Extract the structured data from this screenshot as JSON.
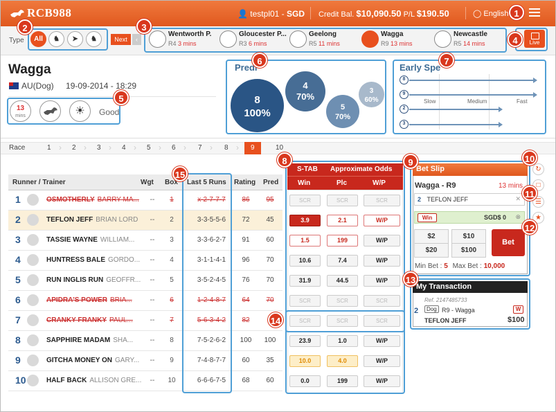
{
  "app": {
    "brand": "RCB988"
  },
  "topbar": {
    "user": "testpl01",
    "currency": "SGD",
    "credit_label": "Credit Bal.",
    "credit_value": "$10,090.50",
    "pl_label": "P/L",
    "pl_value": "$190.50",
    "language": "English"
  },
  "typebar": {
    "label": "Type",
    "all_label": "All",
    "next_label": "Next",
    "prev_glyph": "‹"
  },
  "races": [
    {
      "name": "Wentworth P.",
      "round": "R4",
      "time": "3 mins",
      "kind": "dog"
    },
    {
      "name": "Gloucester P...",
      "round": "R3",
      "time": "6 mins",
      "kind": "horse"
    },
    {
      "name": "Geelong",
      "round": "R5",
      "time": "11 mins",
      "kind": "dog"
    },
    {
      "name": "Wagga",
      "round": "R9",
      "time": "13 mins",
      "kind": "dog"
    },
    {
      "name": "Newcastle",
      "round": "R5",
      "time": "14 mins",
      "kind": "horse"
    }
  ],
  "live_label": "Live",
  "venue": {
    "name": "Wagga",
    "country": "AU(Dog)",
    "date": "19-09-2014 - 18:29",
    "mins_value": "13",
    "mins_unit": "mins",
    "condition": "Good"
  },
  "prediction": {
    "title": "Predi",
    "bubbles": [
      {
        "runner": "8",
        "pct": "100%"
      },
      {
        "runner": "4",
        "pct": "70%"
      },
      {
        "runner": "5",
        "pct": "70%"
      },
      {
        "runner": "3",
        "pct": "60%"
      }
    ]
  },
  "early_speed": {
    "title": "Early Spe",
    "labels": [
      "Slow",
      "Medium",
      "Fast"
    ],
    "rows": [
      {
        "runner": "8",
        "level": 1.0
      },
      {
        "runner": "9",
        "level": 1.0
      },
      {
        "runner": "2",
        "level": 0.72
      },
      {
        "runner": "3",
        "level": 0.72
      }
    ]
  },
  "racebar": {
    "label": "Race",
    "numbers": [
      "1",
      "2",
      "3",
      "4",
      "5",
      "6",
      "7",
      "8",
      "9",
      "10"
    ],
    "selected": "9"
  },
  "grid": {
    "headers": {
      "runner": "Runner / Trainer",
      "wgt": "Wgt",
      "box": "Box",
      "last5": "Last 5 Runs",
      "rating": "Rating",
      "pred": "Pred"
    },
    "rows": [
      {
        "num": "1",
        "horse": "OSMOTHERLY",
        "trainer": "BARRY MA...",
        "wgt": "--",
        "box": "1",
        "last5": "x-2-7-7-7",
        "rating": "86",
        "pred": "95",
        "scr": true,
        "win": "SCR",
        "plc": "SCR",
        "wp": "SCR",
        "style": "scr"
      },
      {
        "num": "2",
        "horse": "TEFLON JEFF",
        "trainer": "BRIAN LORD",
        "wgt": "--",
        "box": "2",
        "last5": "3-3-5-5-6",
        "rating": "72",
        "pred": "45",
        "scr": false,
        "hl": true,
        "win": "3.9",
        "plc": "2.1",
        "wp": "W/P",
        "style": "selected"
      },
      {
        "num": "3",
        "horse": "TASSIE WAYNE",
        "trainer": "WILLIAM...",
        "wgt": "--",
        "box": "3",
        "last5": "3-3-6-2-7",
        "rating": "91",
        "pred": "60",
        "scr": false,
        "win": "1.5",
        "plc": "199",
        "wp": "W/P",
        "style": "redt"
      },
      {
        "num": "4",
        "horse": "HUNTRESS BALE",
        "trainer": "GORDO...",
        "wgt": "--",
        "box": "4",
        "last5": "3-1-1-4-1",
        "rating": "96",
        "pred": "70",
        "scr": false,
        "win": "10.6",
        "plc": "7.4",
        "wp": "W/P",
        "style": "normal"
      },
      {
        "num": "5",
        "horse": "RUN INGLIS RUN",
        "trainer": "GEOFFR...",
        "wgt": "--",
        "box": "5",
        "last5": "3-5-2-4-5",
        "rating": "76",
        "pred": "70",
        "scr": false,
        "win": "31.9",
        "plc": "44.5",
        "wp": "W/P",
        "style": "normal"
      },
      {
        "num": "6",
        "horse": "APIDRA'S POWER",
        "trainer": "BRIA...",
        "wgt": "--",
        "box": "6",
        "last5": "1-2-4-8-7",
        "rating": "64",
        "pred": "70",
        "scr": true,
        "win": "SCR",
        "plc": "SCR",
        "wp": "SCR",
        "style": "scr"
      },
      {
        "num": "7",
        "horse": "CRANKY FRANKY",
        "trainer": "PAUL...",
        "wgt": "--",
        "box": "7",
        "last5": "5-6-3-4-2",
        "rating": "82",
        "pred": "",
        "scr": true,
        "win": "SCR",
        "plc": "SCR",
        "wp": "SCR",
        "style": "scr"
      },
      {
        "num": "8",
        "horse": "SAPPHIRE MADAM",
        "trainer": "SHA...",
        "wgt": "--",
        "box": "8",
        "last5": "7-5-2-6-2",
        "rating": "100",
        "pred": "100",
        "scr": false,
        "win": "23.9",
        "plc": "1.0",
        "wp": "W/P",
        "style": "normal"
      },
      {
        "num": "9",
        "horse": "GITCHA MONEY ON",
        "trainer": "GARY...",
        "wgt": "--",
        "box": "9",
        "last5": "7-4-8-7-7",
        "rating": "60",
        "pred": "35",
        "scr": false,
        "win": "10.0",
        "plc": "4.0",
        "wp": "W/P",
        "style": "yel"
      },
      {
        "num": "10",
        "horse": "HALF BACK",
        "trainer": "ALLISON GRE...",
        "wgt": "--",
        "box": "10",
        "last5": "6-6-6-7-5",
        "rating": "68",
        "pred": "60",
        "scr": false,
        "win": "0.0",
        "plc": "199",
        "wp": "W/P",
        "style": "normal"
      }
    ]
  },
  "odds": {
    "stab": "S-TAB",
    "approx": "Approximate Odds",
    "win": "Win",
    "plc": "Plc",
    "wp": "W/P"
  },
  "betslip": {
    "title": "Bet Slip",
    "race": "Wagga - R9",
    "mins": "13 mins",
    "sel_num": "2",
    "sel_name": "TEFLON JEFF",
    "bet_type": "Win",
    "amount": "SGD$ 0",
    "quick": [
      "$2",
      "$10",
      "$20",
      "$100"
    ],
    "bet_label": "Bet",
    "min_label": "Min Bet :",
    "min_value": "5",
    "max_label": "Max Bet :",
    "max_value": "10,000"
  },
  "transaction": {
    "title": "My Transaction",
    "ref": "Ref. 2147485733",
    "num": "2",
    "kind": "Dog",
    "race": "R9 - Wagga",
    "type": "W",
    "horse": "TEFLON JEFF",
    "amount": "$100"
  },
  "callouts": [
    "1",
    "2",
    "3",
    "4",
    "5",
    "6",
    "7",
    "8",
    "9",
    "10",
    "11",
    "12",
    "13",
    "14",
    "15"
  ],
  "colors": {
    "accent": "#e8501e",
    "odds_red": "#c8281d",
    "link_blue": "#2d5b8f",
    "highlight_blue": "#4f9fd6"
  }
}
